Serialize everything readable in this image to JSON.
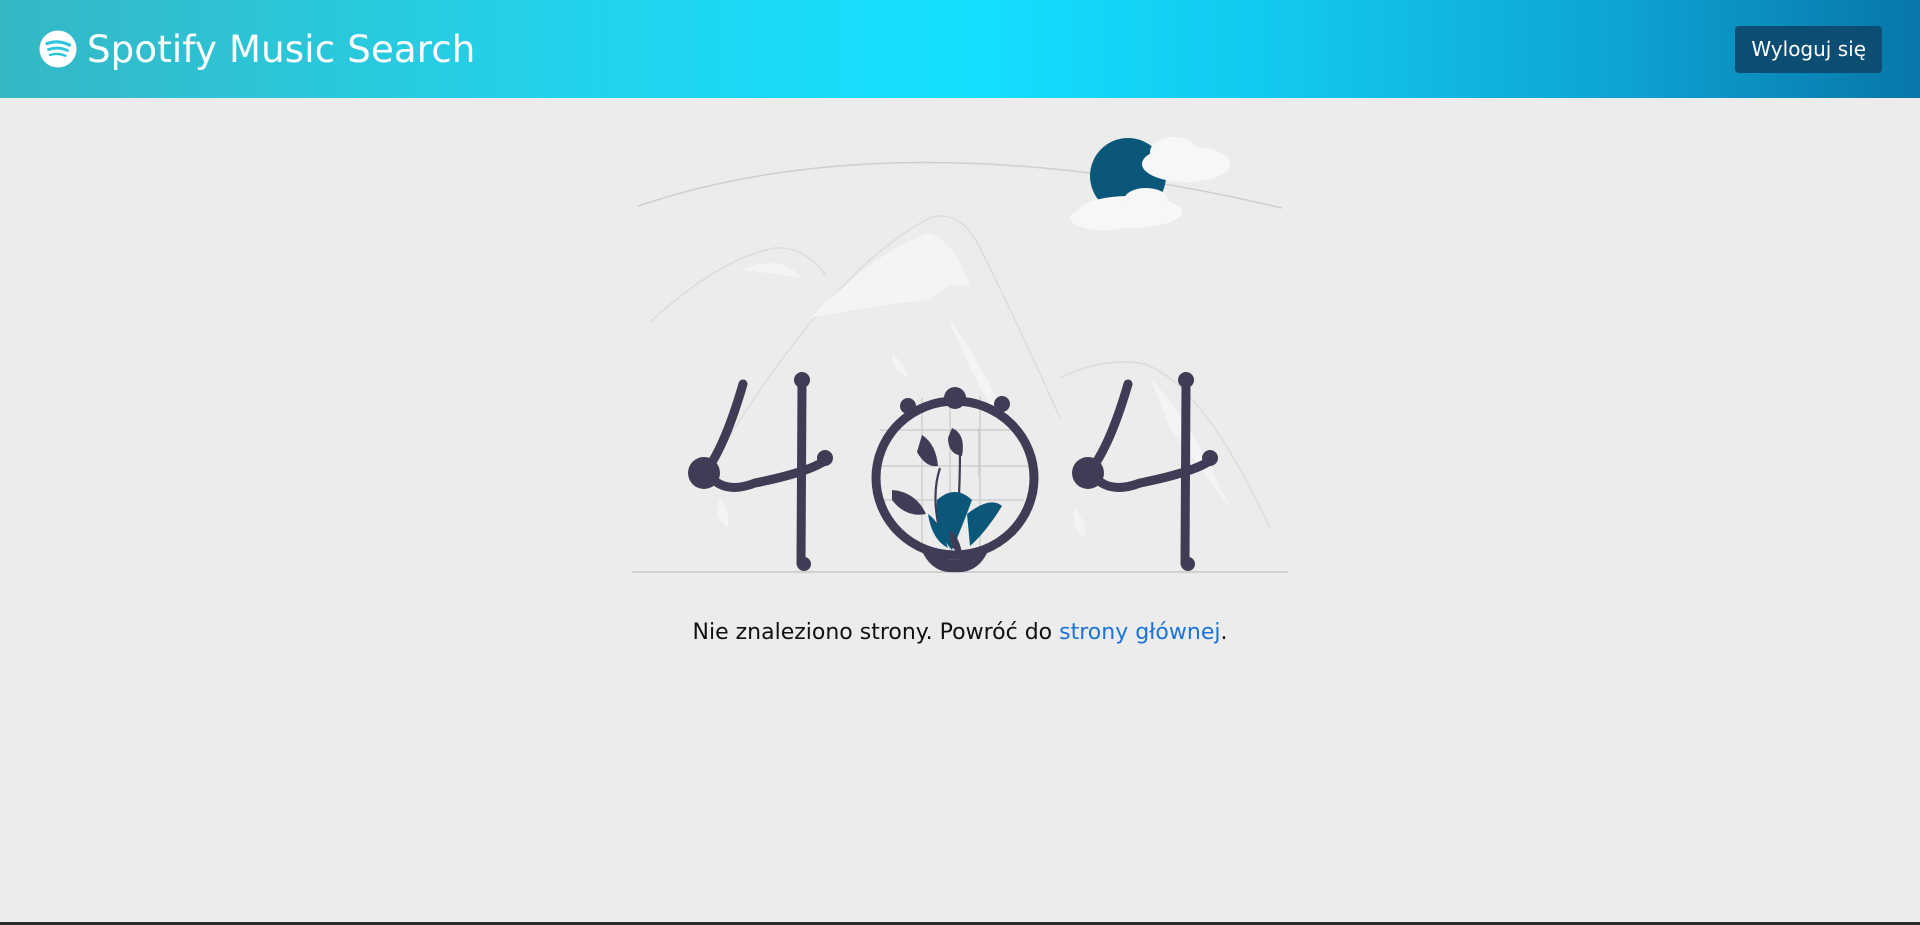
{
  "navbar": {
    "brand_icon": "spotify-logo-icon",
    "brand_title": "Spotify Music Search",
    "logout_label": "Wyloguj się"
  },
  "error_page": {
    "illustration": "404-illustration",
    "message_prefix": "Nie znaleziono strony. Powróć do ",
    "home_link_label": "strony głównej",
    "message_suffix": "."
  },
  "colors": {
    "navbar_gradient_start": "#35b7c4",
    "navbar_gradient_mid": "#14e0ff",
    "navbar_gradient_end": "#0876a8",
    "logout_button": "#0c4d74",
    "link": "#1a73d9",
    "page_background": "#ececec",
    "illustration_dark": "#3f3d56",
    "illustration_accent": "#0b577a"
  }
}
